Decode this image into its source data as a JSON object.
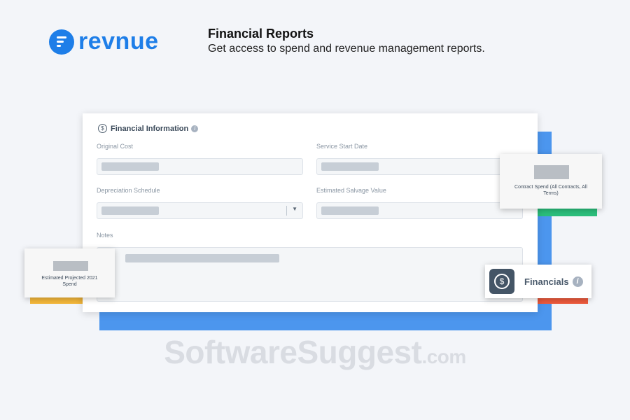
{
  "colors": {
    "brand": "#1e7ee8",
    "blue_accent": "#4c96ee",
    "green_accent": "#2bbf7c",
    "yellow_accent": "#f4b73a",
    "red_accent": "#ef5a3d"
  },
  "logo": {
    "text": "revnue",
    "icon": "revnue-logo-icon"
  },
  "header": {
    "title": "Financial Reports",
    "subtitle": "Get access to spend and revenue management reports."
  },
  "form": {
    "title": "Financial Information",
    "icon": "dollar-circle-icon",
    "fields": {
      "original_cost": "Original Cost",
      "service_start_date": "Service Start Date",
      "depreciation_schedule": "Depreciation Schedule",
      "estimated_salvage_value": "Estimated Salvage Value",
      "notes": "Notes"
    }
  },
  "popups": {
    "contract_spend": "Contract Spend (All Contracts, All Terms)",
    "projected_spend": "Estimated Projected 2021 Spend"
  },
  "badge": {
    "label": "Financials",
    "icon": "dollar-circle-icon",
    "info": "i"
  },
  "watermark": {
    "main": "SoftwareSuggest",
    "suffix": ".com"
  }
}
